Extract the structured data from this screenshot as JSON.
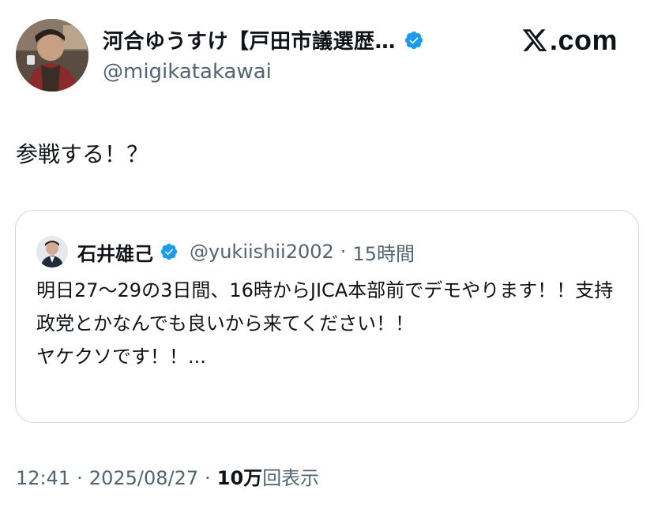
{
  "header": {
    "display_name": "河合ゆうすけ【戸田市議選歴…",
    "handle": "@migikatakawai",
    "verified_icon": "verified-badge-icon",
    "brand_text": ".com",
    "brand_icon": "x-logo-icon"
  },
  "tweet": {
    "text": "参戦する！？"
  },
  "quote": {
    "name": "石井雄己",
    "handle": "@yukiishii2002",
    "separator": "·",
    "time": "15時間",
    "text": "明日27〜29の3日間、16時からJICA本部前でデモやります！！支持政党とかなんでも良いから来てください！！\nヤケクソです！！..."
  },
  "meta": {
    "time": "12:41",
    "separator": "·",
    "date": "2025/08/27",
    "views_count": "10万",
    "views_label": "回表示"
  },
  "colors": {
    "text": "#0f1419",
    "secondary": "#536471",
    "verified": "#1d9bf0",
    "border": "#cfd9de"
  }
}
